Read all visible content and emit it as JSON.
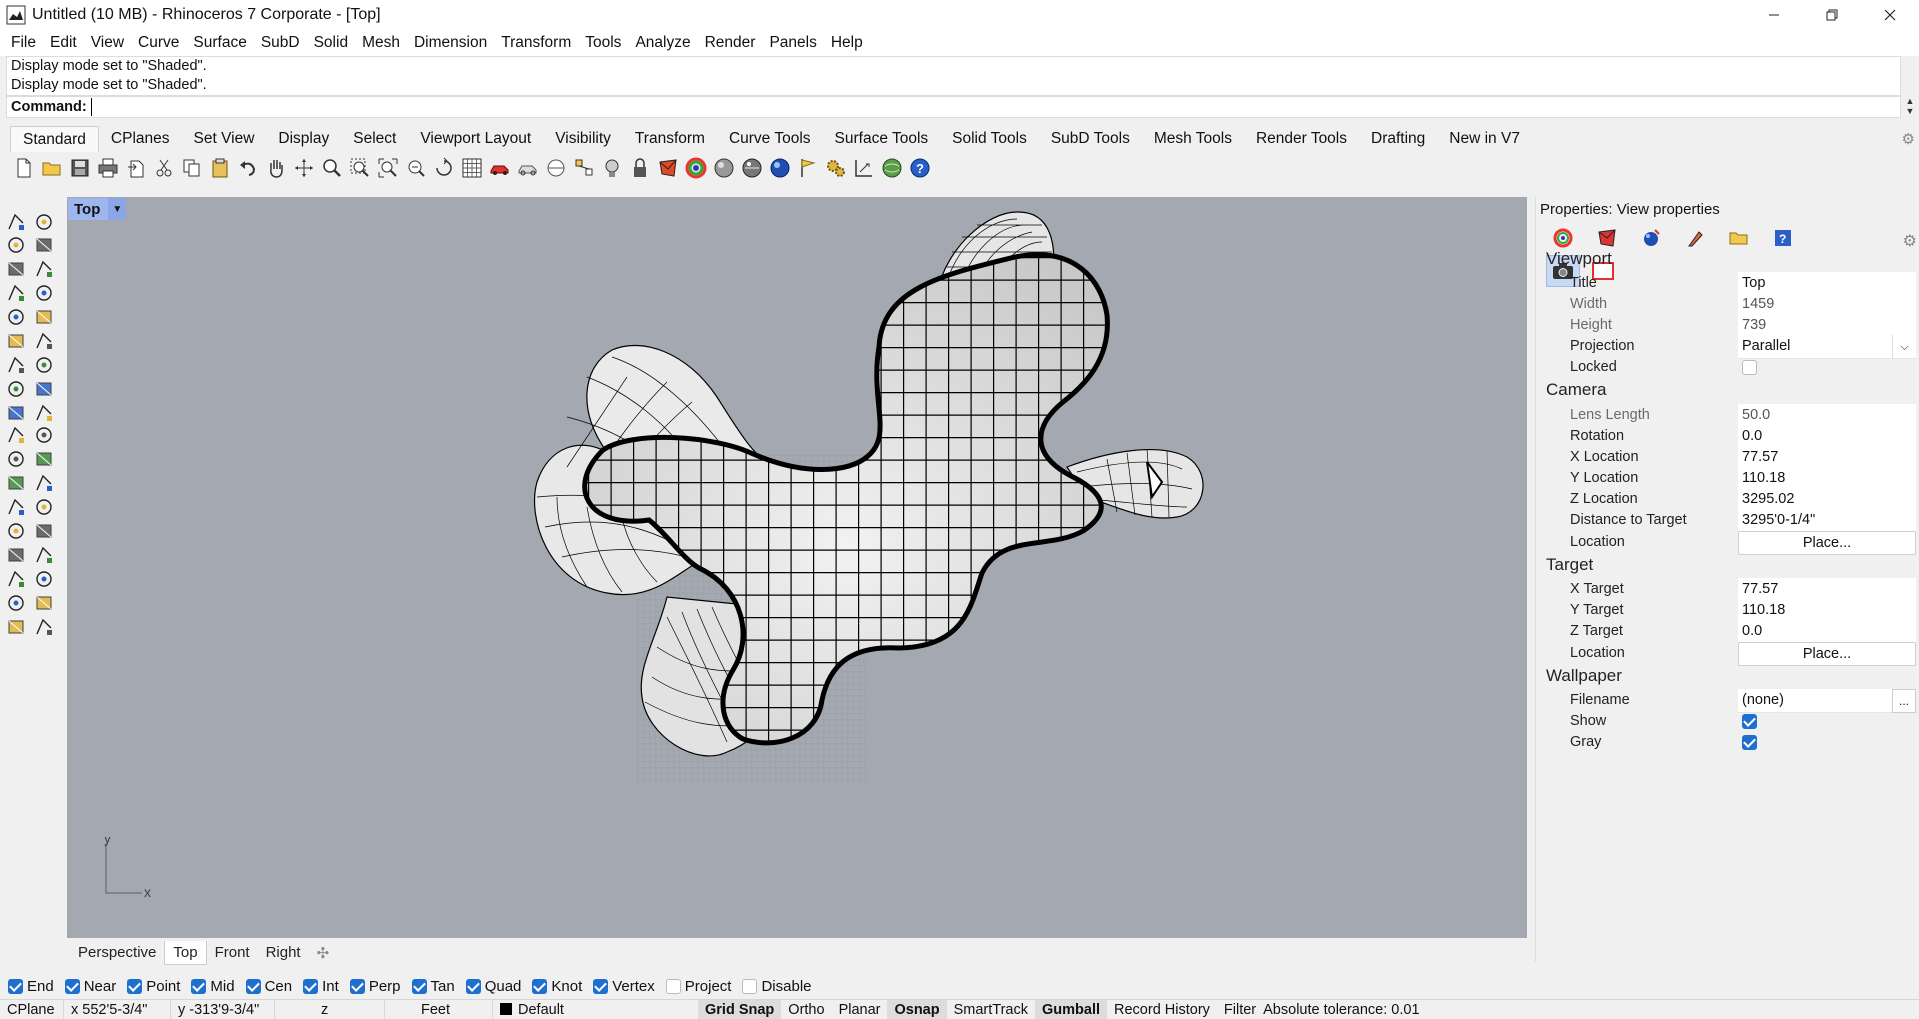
{
  "window": {
    "title": "Untitled (10 MB) - Rhinoceros 7 Corporate - [Top]",
    "minimize_icon": "minimize-icon",
    "maximize_icon": "restore-icon",
    "close_icon": "close-icon"
  },
  "menu": [
    "File",
    "Edit",
    "View",
    "Curve",
    "Surface",
    "SubD",
    "Solid",
    "Mesh",
    "Dimension",
    "Transform",
    "Tools",
    "Analyze",
    "Render",
    "Panels",
    "Help"
  ],
  "command_history": [
    "Display mode set to \"Shaded\".",
    "Display mode set to \"Shaded\"."
  ],
  "command": {
    "label": "Command:",
    "value": ""
  },
  "toolbar_tabs": [
    "Standard",
    "CPlanes",
    "Set View",
    "Display",
    "Select",
    "Viewport Layout",
    "Visibility",
    "Transform",
    "Curve Tools",
    "Surface Tools",
    "Solid Tools",
    "SubD Tools",
    "Mesh Tools",
    "Render Tools",
    "Drafting",
    "New in V7"
  ],
  "active_toolbar_tab": "Standard",
  "viewport": {
    "name": "Top",
    "axis_x": "x",
    "axis_y": "y",
    "background": "#a3a8b1"
  },
  "viewport_tabs": [
    "Perspective",
    "Top",
    "Front",
    "Right"
  ],
  "active_viewport_tab": "Top",
  "osnaps": [
    {
      "label": "End",
      "checked": true
    },
    {
      "label": "Near",
      "checked": true
    },
    {
      "label": "Point",
      "checked": true
    },
    {
      "label": "Mid",
      "checked": true
    },
    {
      "label": "Cen",
      "checked": true
    },
    {
      "label": "Int",
      "checked": true
    },
    {
      "label": "Perp",
      "checked": true
    },
    {
      "label": "Tan",
      "checked": true
    },
    {
      "label": "Quad",
      "checked": true
    },
    {
      "label": "Knot",
      "checked": true
    },
    {
      "label": "Vertex",
      "checked": true
    },
    {
      "label": "Project",
      "checked": false
    },
    {
      "label": "Disable",
      "checked": false
    }
  ],
  "status": {
    "cplane": "CPlane",
    "x": "x 552'5-3/4\"",
    "y": "y -313'9-3/4\"",
    "z": "z",
    "units": "Feet",
    "layer": "Default",
    "panes": [
      "Grid Snap",
      "Ortho",
      "Planar",
      "Osnap",
      "SmartTrack",
      "Gumball",
      "Record History",
      "Filter"
    ],
    "bold_panes": [
      "Grid Snap",
      "Osnap",
      "Gumball"
    ],
    "tolerance": "Absolute tolerance: 0.01"
  },
  "properties": {
    "title": "Properties: View properties",
    "tab_icons": [
      "color-wheel-icon",
      "material-icon",
      "environment-icon",
      "render-brush-icon",
      "folder-icon",
      "help-icon"
    ],
    "sub_icons": [
      "camera-icon",
      "viewport-frame-icon"
    ],
    "sections": {
      "viewport": "Viewport",
      "camera": "Camera",
      "target": "Target",
      "wallpaper": "Wallpaper"
    },
    "viewport_rows": [
      {
        "label": "Title",
        "value": "Top"
      },
      {
        "label": "Width",
        "value": "1459"
      },
      {
        "label": "Height",
        "value": "739"
      },
      {
        "label": "Projection",
        "value": "Parallel"
      },
      {
        "label": "Locked",
        "value": ""
      }
    ],
    "locked": false,
    "camera_rows": [
      {
        "label": "Lens Length",
        "value": "50.0"
      },
      {
        "label": "Rotation",
        "value": "0.0"
      },
      {
        "label": "X Location",
        "value": "77.57"
      },
      {
        "label": "Y Location",
        "value": "110.18"
      },
      {
        "label": "Z Location",
        "value": "3295.02"
      },
      {
        "label": "Distance to Target",
        "value": "3295'0-1/4\""
      },
      {
        "label": "Location",
        "value": "Place..."
      }
    ],
    "target_rows": [
      {
        "label": "X Target",
        "value": "77.57"
      },
      {
        "label": "Y Target",
        "value": "110.18"
      },
      {
        "label": "Z Target",
        "value": "0.0"
      },
      {
        "label": "Location",
        "value": "Place..."
      }
    ],
    "wallpaper_rows": [
      {
        "label": "Filename",
        "value": "(none)"
      },
      {
        "label": "Show",
        "value": ""
      },
      {
        "label": "Gray",
        "value": ""
      }
    ],
    "wallpaper_show": true,
    "wallpaper_gray": true,
    "browse_label": "..."
  }
}
